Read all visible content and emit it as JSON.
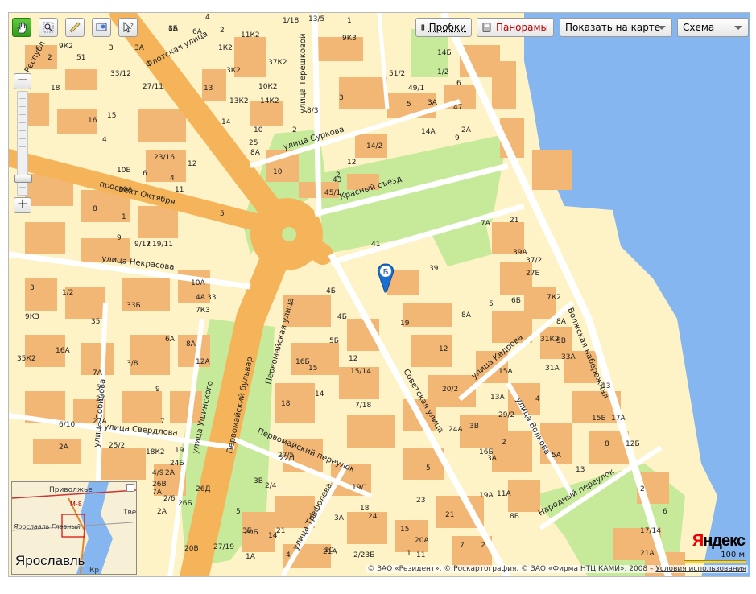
{
  "toolbar": {
    "tools": [
      {
        "name": "hand-icon",
        "active": true
      },
      {
        "name": "magnifier-icon",
        "active": false
      },
      {
        "name": "ruler-icon",
        "active": false
      },
      {
        "name": "route-icon",
        "active": false
      },
      {
        "name": "info-cursor-icon",
        "active": false
      }
    ],
    "traffic_label": "Пробки",
    "panoramas_label": "Панорамы",
    "show_on_map_label": "Показать на карте",
    "map_type_value": "Схема"
  },
  "zoom": {
    "plus": "+",
    "minus": "−",
    "level_fraction": 0.88
  },
  "streets": {
    "flotskaya": "Флотская улица",
    "tereshkovoy": "улица Терешковой",
    "surkova": "улица Суркова",
    "krasny_sezd": "Красный съезд",
    "prospekt_oktyabrya": "проспект Октября",
    "nekrasova": "улица Некрасова",
    "pervomaysky_bulvar": "Первомайский бульвар",
    "pervomayskaya": "Первомайская улица",
    "ushinskogo": "улица Ушинского",
    "sobinova": "улица Собинова",
    "sverdlova": "улица Свердлова",
    "pervomaysky_pereulok": "Первомайский переулок",
    "trefoleva": "улица Трефолева",
    "sovetskaya": "Советская улица",
    "kedrova": "улица Кедрова",
    "volkova": "улица Волкова",
    "narodny_pereulok": "Народный переулок",
    "volzhskaya_nab": "Волжская набережная",
    "respubl": "Республ"
  },
  "house_numbers": [
    "8Б",
    "6А",
    "4",
    "2",
    "1/18",
    "13/5",
    "1",
    "9К2",
    "3",
    "3А",
    "1К2",
    "11К2",
    "9К3",
    "37К2",
    "14Б",
    "2",
    "51",
    "51/2",
    "33/12",
    "3К2",
    "1/2",
    "27/11",
    "10К2",
    "18",
    "49/1",
    "13",
    "13К2",
    "14К2",
    "6",
    "3",
    "8/3",
    "3А",
    "47",
    "15",
    "16",
    "14",
    "10",
    "2",
    "5",
    "4",
    "2А",
    "25",
    "14А",
    "9",
    "23/16",
    "8А",
    "14/2",
    "12",
    "12",
    "10",
    "10Б",
    "6",
    "2",
    "4",
    "11",
    "10А",
    "45/1",
    "43",
    "7А",
    "21",
    "1",
    "5",
    "8",
    "9",
    "9/12",
    "7",
    "41",
    "39",
    "39А",
    "37/2",
    "27Б",
    "7К2",
    "3",
    "1/2",
    "10А",
    "19/11",
    "4Б",
    "4А",
    "7К3",
    "5",
    "6Б",
    "4Б",
    "19",
    "8А",
    "8А",
    "35",
    "33Б",
    "33",
    "31К2",
    "5В",
    "9К3",
    "5Б",
    "6А",
    "8А",
    "12",
    "33А",
    "31А",
    "35К2",
    "16А",
    "12А",
    "7А",
    "12",
    "15А",
    "3/8",
    "9",
    "15/14",
    "16Б",
    "15",
    "13",
    "13А",
    "29/2",
    "4",
    "5",
    "7",
    "14",
    "18",
    "20/2",
    "15Б",
    "17А",
    "6/10",
    "27А",
    "27",
    "7/18",
    "2",
    "8",
    "12Б",
    "2А",
    "25/2",
    "18К2",
    "19",
    "24Б",
    "22/1",
    "24А",
    "3В",
    "16Б",
    "7А",
    "4/9",
    "2А",
    "5",
    "3А",
    "5А",
    "26Д",
    "26В",
    "27/5",
    "13",
    "3В",
    "2/4",
    "19/1",
    "19А",
    "11А",
    "2",
    "2/6",
    "2А",
    "23",
    "26Б",
    "18",
    "24",
    "21",
    "8Б",
    "6",
    "5",
    "3Б",
    "21",
    "12",
    "15",
    "20А",
    "20Б",
    "14",
    "2",
    "3А",
    "21А",
    "17/14",
    "27/19",
    "10",
    "4",
    "2/23Б",
    "1",
    "21А",
    "20В",
    "1А",
    "7",
    "11",
    "1А"
  ],
  "minimap": {
    "title": "Ярославль",
    "places": [
      "Приволжье",
      "Ярославль Главный"
    ],
    "road_label": "М-8",
    "edge_labels": [
      "Тве",
      "Кр"
    ]
  },
  "marker_label": "Б",
  "logo_text": "Яндекс",
  "scale_label": "100 м",
  "copyright": {
    "text": "© ЗАО «Резидент», © Роскартография, © ЗАО «Фирма НТЦ КАМИ», 2008 –",
    "terms_link": "Условия использования"
  },
  "colors": {
    "background": "#fdf3c6",
    "building": "#f2b774",
    "park": "#c7ea9a",
    "water": "#86b6ef",
    "main_road": "#f5b45a",
    "secondary_road": "#ffffff",
    "active_tool": "#3fb32a"
  }
}
